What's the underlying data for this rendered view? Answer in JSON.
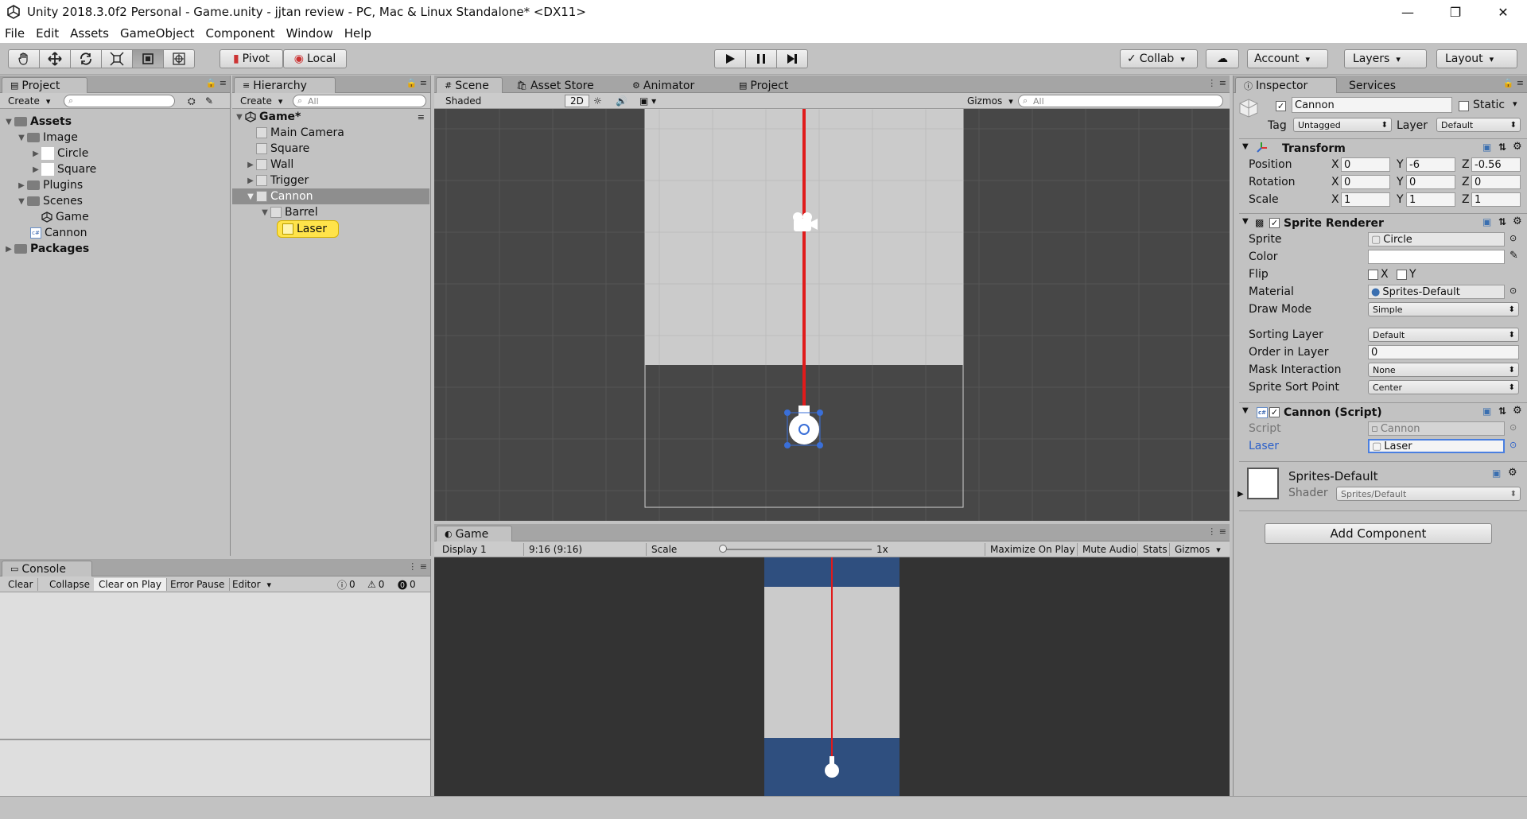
{
  "window": {
    "title": "Unity 2018.3.0f2 Personal - Game.unity - jjtan review - PC, Mac & Linux Standalone* <DX11>",
    "minimize": "—",
    "restore": "❐",
    "close": "✕"
  },
  "menu": [
    "File",
    "Edit",
    "Assets",
    "GameObject",
    "Component",
    "Window",
    "Help"
  ],
  "toolbar": {
    "pivot": "Pivot",
    "local": "Local",
    "collab": "Collab",
    "account": "Account",
    "layers": "Layers",
    "layout": "Layout"
  },
  "project": {
    "tab": "Project",
    "create": "Create",
    "tree": [
      {
        "label": "Assets",
        "bold": true
      },
      {
        "label": "Image"
      },
      {
        "label": "Circle"
      },
      {
        "label": "Square"
      },
      {
        "label": "Plugins"
      },
      {
        "label": "Scenes"
      },
      {
        "label": "Game"
      },
      {
        "label": "Cannon"
      },
      {
        "label": "Packages",
        "bold": true
      }
    ]
  },
  "hierarchy": {
    "tab": "Hierarchy",
    "create": "Create",
    "search_placeholder": "All",
    "scene": "Game*",
    "items": [
      "Main Camera",
      "Square",
      "Wall",
      "Trigger",
      "Cannon",
      "Barrel",
      "Laser"
    ]
  },
  "scene_tabs": {
    "scene": "Scene",
    "asset_store": "Asset Store",
    "animator": "Animator",
    "project": "Project",
    "shaded": "Shaded",
    "mode_2d": "2D",
    "gizmos": "Gizmos",
    "search_placeholder": "All"
  },
  "game": {
    "tab": "Game",
    "display": "Display 1",
    "aspect": "9:16 (9:16)",
    "scale_label": "Scale",
    "scale_value": "1x",
    "maximize": "Maximize On Play",
    "mute": "Mute Audio",
    "stats": "Stats",
    "gizmos": "Gizmos"
  },
  "console": {
    "tab": "Console",
    "clear": "Clear",
    "collapse": "Collapse",
    "clear_on_play": "Clear on Play",
    "error_pause": "Error Pause",
    "editor": "Editor",
    "count_log": "0",
    "count_warn": "0",
    "count_error": "0"
  },
  "inspector": {
    "tab": "Inspector",
    "services": "Services",
    "name": "Cannon",
    "static": "Static",
    "tag_label": "Tag",
    "tag": "Untagged",
    "layer_label": "Layer",
    "layer": "Default",
    "transform": {
      "title": "Transform",
      "position_label": "Position",
      "rotation_label": "Rotation",
      "scale_label": "Scale",
      "position": [
        "0",
        "-6",
        "-0.56"
      ],
      "rotation": [
        "0",
        "0",
        "0"
      ],
      "scale": [
        "1",
        "1",
        "1"
      ]
    },
    "sprite_renderer": {
      "title": "Sprite Renderer",
      "sprite_label": "Sprite",
      "sprite": "Circle",
      "color_label": "Color",
      "flip_label": "Flip",
      "flip_x": "X",
      "flip_y": "Y",
      "material_label": "Material",
      "material": "Sprites-Default",
      "draw_mode_label": "Draw Mode",
      "draw_mode": "Simple",
      "sorting_layer_label": "Sorting Layer",
      "sorting_layer": "Default",
      "order_label": "Order in Layer",
      "order": "0",
      "mask_label": "Mask Interaction",
      "mask": "None",
      "sort_point_label": "Sprite Sort Point",
      "sort_point": "Center"
    },
    "cannon_script": {
      "title": "Cannon (Script)",
      "script_label": "Script",
      "script": "Cannon",
      "laser_label": "Laser",
      "laser": "Laser"
    },
    "material": {
      "name": "Sprites-Default",
      "shader_label": "Shader",
      "shader": "Sprites/Default"
    },
    "add_component": "Add Component"
  },
  "colors": {
    "laser": "#e01b1b",
    "game_blue": "#2f4f7f",
    "selection": "#ffe34a",
    "scene_bg": "#474747"
  }
}
